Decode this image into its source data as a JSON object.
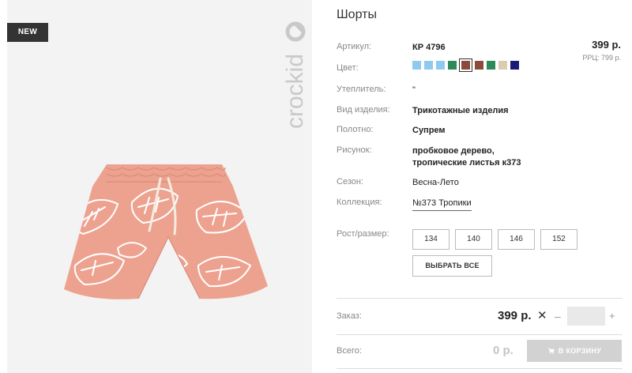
{
  "badge": "NEW",
  "brand": "crockid",
  "product": {
    "title": "Шорты",
    "rows": {
      "article": {
        "label": "Артикул:",
        "value": "КР 4796"
      },
      "color": {
        "label": "Цвет:"
      },
      "insulation": {
        "label": "Утеплитель:",
        "value": "\""
      },
      "type": {
        "label": "Вид изделия:",
        "value": "Трикотажные изделия"
      },
      "fabric": {
        "label": "Полотно:",
        "value": "Супрем"
      },
      "pattern": {
        "label": "Рисунок:",
        "value_line1": "пробковое дерево,",
        "value_line2": "тропические листья к373"
      },
      "season": {
        "label": "Сезон:",
        "value": "Весна-Лето"
      },
      "collection": {
        "label": "Коллекция:",
        "value": "№373 Тропики"
      },
      "size": {
        "label": "Рост/размер:"
      }
    },
    "price": "399 р.",
    "rrp": "РРЦ: 799 р.",
    "swatches": [
      "#8ecaf0",
      "#8ecaf0",
      "#8ecaf0",
      "#2e8b57",
      "#8b4a3c",
      "#8b4a3c",
      "#2e8b57",
      "#d9ccb0",
      "#1a1a7a"
    ],
    "selected_swatch": 4,
    "sizes": [
      "134",
      "140",
      "146",
      "152"
    ],
    "select_all": "ВЫБРАТЬ ВСЕ"
  },
  "order": {
    "label": "Заказ:",
    "price": "399 р.",
    "multiply": "✕",
    "minus": "–",
    "plus": "+",
    "quantity": ""
  },
  "total": {
    "label": "Всего:",
    "price": "0 р.",
    "cart_button": "В КОРЗИНУ"
  },
  "colors": {
    "shorts": "#eda28f",
    "print": "#ffffff",
    "logo": "#c9c9c9",
    "cart_disabled": "#d2d2d2"
  }
}
